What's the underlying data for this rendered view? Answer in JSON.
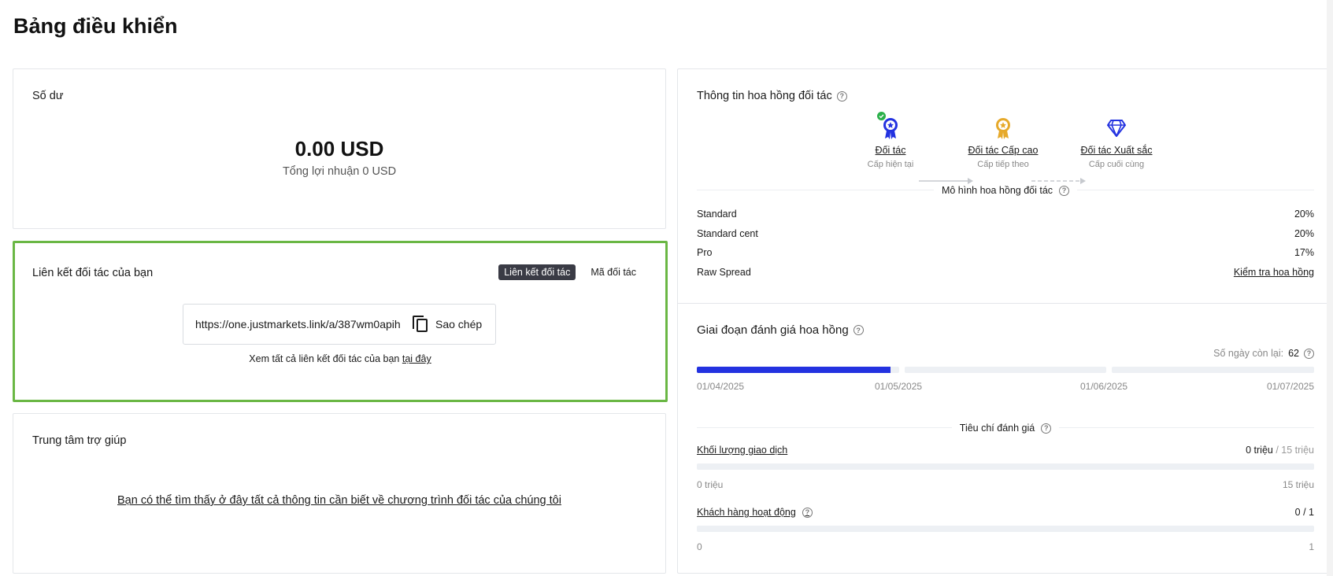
{
  "page": {
    "title": "Bảng điều khiển"
  },
  "balance": {
    "title": "Số dư",
    "amount": "0.00 USD",
    "total_profit": "Tổng lợi nhuận 0 USD"
  },
  "partner_link": {
    "title": "Liên kết đối tác của bạn",
    "tabs": [
      {
        "label": "Liên kết đối tác",
        "active": true
      },
      {
        "label": "Mã đối tác",
        "active": false
      }
    ],
    "url": "https://one.justmarkets.link/a/387wm0apih",
    "copy_label": "Sao chép",
    "footer_text": "Xem tất cả liên kết đối tác của bạn ",
    "footer_link": "tại đây"
  },
  "help_center": {
    "title": "Trung tâm trợ giúp",
    "link_text": "Bạn có thể tìm thấy ở đây tất cả thông tin cần biết về chương trình đối tác của chúng tôi"
  },
  "commission": {
    "title": "Thông tin hoa hồng đối tác",
    "tiers": [
      {
        "name": "Đối tác",
        "sub": "Cấp hiện tại",
        "icon": "ribbon-medal-icon",
        "color": "#2332e0",
        "current": true
      },
      {
        "name": "Đối tác Cấp cao",
        "sub": "Cấp tiếp theo",
        "icon": "gold-medal-icon",
        "color": "#e6a92a",
        "current": false
      },
      {
        "name": "Đối tác Xuất sắc",
        "sub": "Cấp cuối cùng",
        "icon": "diamond-icon",
        "color": "#2332e0",
        "current": false
      }
    ],
    "model_title": "Mô hình hoa hồng đối tác",
    "models": [
      {
        "name": "Standard",
        "value": "20%"
      },
      {
        "name": "Standard cent",
        "value": "20%"
      },
      {
        "name": "Pro",
        "value": "17%"
      },
      {
        "name": "Raw Spread",
        "value": "Kiểm tra hoa hồng"
      }
    ]
  },
  "evaluation": {
    "title": "Giai đoạn đánh giá hoa hồng",
    "days_left_label": "Số ngày còn lại:",
    "days_left_value": "62",
    "dates": [
      "01/04/2025",
      "01/05/2025",
      "01/06/2025",
      "01/07/2025"
    ],
    "progress_segments": [
      0.96,
      0,
      0
    ],
    "criteria_title": "Tiêu chí đánh giá",
    "criteria": [
      {
        "name": "Khối lượng giao dịch",
        "current": "0 triệu",
        "target": " / 15 triệu",
        "min": "0 triệu",
        "max": "15 triệu",
        "progress": 0
      },
      {
        "name": "Khách hàng hoạt động",
        "current": "0 / 1",
        "target": "",
        "min": "0",
        "max": "1",
        "progress": 0
      }
    ]
  },
  "colors": {
    "accent": "#2332e0",
    "highlight_border": "#6ab744",
    "gold": "#e6a92a",
    "check": "#2bb04a"
  }
}
